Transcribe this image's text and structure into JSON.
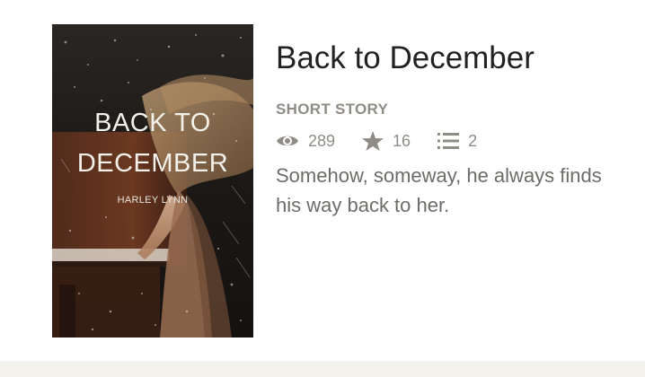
{
  "cover": {
    "title_line1": "BACK TO",
    "title_line2": "DECEMBER",
    "author": "HARLEY LYNN",
    "icon": "book-cover-image"
  },
  "story": {
    "title": "Back to December",
    "category": "SHORT STORY",
    "stats": {
      "reads": "289",
      "votes": "16",
      "parts": "2",
      "reads_icon": "eye-icon",
      "votes_icon": "star-icon",
      "parts_icon": "list-icon"
    },
    "description": "Somehow, someway, he always finds his way back to her."
  },
  "colors": {
    "title": "#222222",
    "meta": "#8f8c86",
    "description": "#6e6c68",
    "footer": "#f2f1ec"
  }
}
